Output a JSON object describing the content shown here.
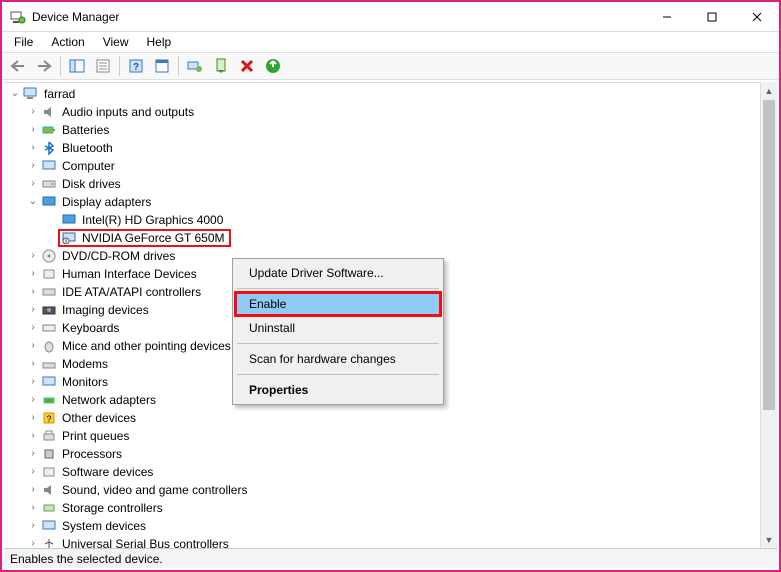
{
  "window": {
    "title": "Device Manager"
  },
  "menu": {
    "file": "File",
    "action": "Action",
    "view": "View",
    "help": "Help"
  },
  "tree": {
    "root": "farrad",
    "items": [
      "Audio inputs and outputs",
      "Batteries",
      "Bluetooth",
      "Computer",
      "Disk drives",
      "Display adapters",
      "DVD/CD-ROM drives",
      "Human Interface Devices",
      "IDE ATA/ATAPI controllers",
      "Imaging devices",
      "Keyboards",
      "Mice and other pointing devices",
      "Modems",
      "Monitors",
      "Network adapters",
      "Other devices",
      "Print queues",
      "Processors",
      "Software devices",
      "Sound, video and game controllers",
      "Storage controllers",
      "System devices",
      "Universal Serial Bus controllers"
    ],
    "display_children": [
      "Intel(R) HD Graphics 4000",
      "NVIDIA GeForce GT 650M"
    ]
  },
  "context_menu": {
    "update": "Update Driver Software...",
    "enable": "Enable",
    "uninstall": "Uninstall",
    "scan": "Scan for hardware changes",
    "properties": "Properties"
  },
  "statusbar": {
    "text": "Enables the selected device."
  }
}
